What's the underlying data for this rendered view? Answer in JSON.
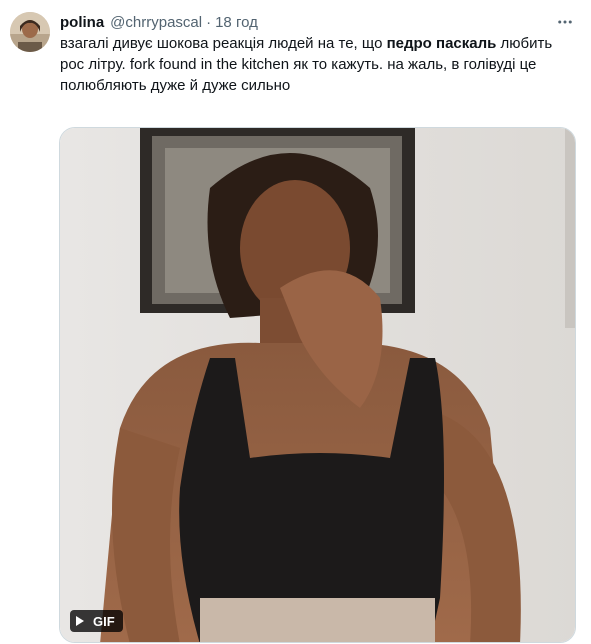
{
  "tweet": {
    "author_name": "polina",
    "handle": "@chrrypascal",
    "separator": "·",
    "time": "18 год",
    "text_part1": "взагалі дивує шокова реакція людей на те, що ",
    "text_bold": "педро паскаль",
    "text_part2": " любить рос літру. fork found in the kitchen як то кажуть. на жаль, в голівуді це полюбляють дуже й дуже сильно",
    "media_badge": "GIF"
  },
  "icons": {
    "more": "more-horizontal-icon",
    "play": "play-icon"
  },
  "colors": {
    "text_primary": "#0f1419",
    "text_secondary": "#536471",
    "border": "#cfd9de"
  }
}
